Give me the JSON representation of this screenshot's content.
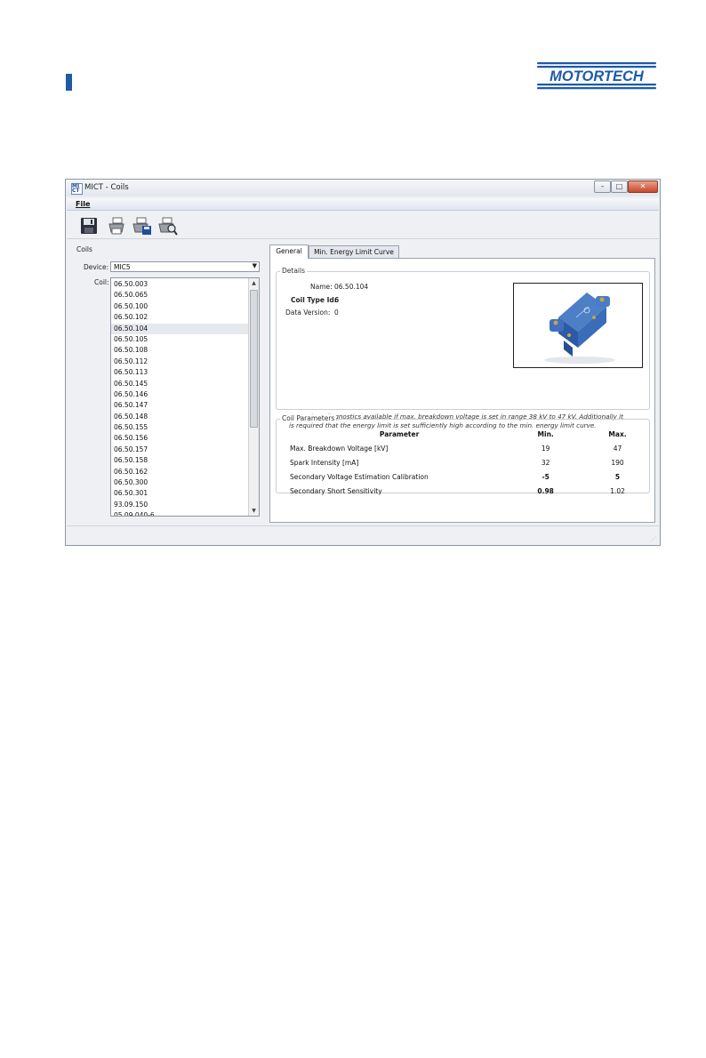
{
  "brand": {
    "logo_text": "MOTORTECH",
    "color": "#1d5aa8"
  },
  "window": {
    "title": "MICT - Coils",
    "app_icon": "mict-app-icon",
    "controls": {
      "minimize": "–",
      "maximize": "□",
      "close": "✕"
    }
  },
  "menu": {
    "file": "File"
  },
  "toolbar": {
    "buttons": [
      {
        "name": "save-icon"
      },
      {
        "name": "print-icon"
      },
      {
        "name": "print-save-icon"
      },
      {
        "name": "print-preview-icon"
      }
    ]
  },
  "coils": {
    "group_label": "Coils",
    "device_label": "Device:",
    "device_value": "MIC5",
    "coil_label": "Coil:",
    "selected_index": 4,
    "items": [
      "06.50.003",
      "06.50.065",
      "06.50.100",
      "06.50.102",
      "06.50.104",
      "06.50.105",
      "06.50.108",
      "06.50.112",
      "06.50.113",
      "06.50.145",
      "06.50.146",
      "06.50.147",
      "06.50.148",
      "06.50.155",
      "06.50.156",
      "06.50.157",
      "06.50.158",
      "06.50.162",
      "06.50.300",
      "06.50.301",
      "93.09.150",
      "05.09.040-6"
    ]
  },
  "tabs": {
    "general": "General",
    "energy_curve": "Min. Energy Limit Curve"
  },
  "details": {
    "group_label": "Details",
    "name_label": "Name:",
    "name_value": "06.50.104",
    "type_label": "Coil Type Id:",
    "type_value": "6",
    "version_label": "Data Version:",
    "version_value": "0",
    "note": "Secondary diagnostics available if max. breakdown voltage is set in range 38 kV to 47 kV. Additionally it is required that the energy limit is set sufficiently high according to the min. energy limit curve.",
    "image_name": "ignition-coil-photo"
  },
  "parameters": {
    "group_label": "Coil Parameters",
    "headers": {
      "param": "Parameter",
      "min": "Min.",
      "max": "Max."
    },
    "rows": [
      {
        "name": "Max. Breakdown Voltage [kV]",
        "min": "19",
        "max": "47"
      },
      {
        "name": "Spark Intensity [mA]",
        "min": "32",
        "max": "190"
      },
      {
        "name": "Secondary Voltage Estimation Calibration",
        "min": "-5",
        "max": "5"
      },
      {
        "name": "Secondary Short Sensitivity",
        "min": "0.98",
        "max": "1.02"
      }
    ]
  }
}
